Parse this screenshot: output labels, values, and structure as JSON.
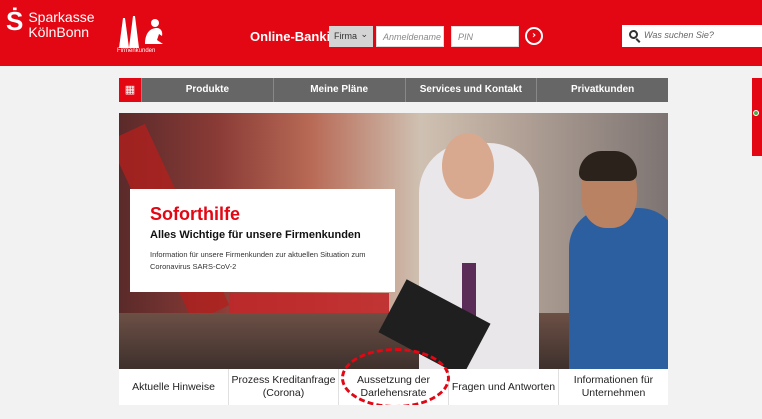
{
  "header": {
    "logo_symbol": "Ṡ",
    "logo_line1": "Sparkasse",
    "logo_line2": "KölnBonn",
    "brand_caption": "Firmenkunden",
    "online_banking_label": "Online-Banking",
    "account_type": "Firma",
    "username_placeholder": "Anmeldename",
    "pin_placeholder": "PIN",
    "search_placeholder": "Was suchen Sie?",
    "accent_color": "#e30613"
  },
  "nav": {
    "items": [
      {
        "label": "Produkte"
      },
      {
        "label": "Meine Pläne"
      },
      {
        "label": "Services und Kontakt"
      },
      {
        "label": "Privatkunden"
      }
    ]
  },
  "promo": {
    "title": "Soforthilfe",
    "subtitle": "Alles Wichtige für unsere Firmenkunden",
    "text": "Information für unsere Firmenkunden zur aktuellen Situation zum Coronavirus SARS-CoV-2"
  },
  "tabs": [
    {
      "label": "Aktuelle Hinweise"
    },
    {
      "label": "Prozess Kreditanfrage (Corona)"
    },
    {
      "label": "Aussetzung der Darlehensrate"
    },
    {
      "label": "Fragen und Antworten"
    },
    {
      "label": "Informationen für Unternehmen"
    }
  ]
}
